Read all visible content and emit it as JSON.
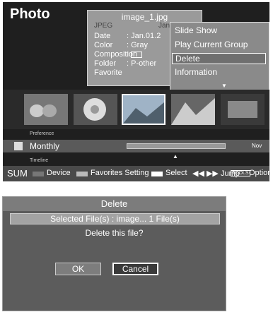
{
  "photo_screen": {
    "title": "Photo",
    "info": {
      "filename": "image_1.jpg",
      "dimension_text": "JPEG",
      "bg_text": "Jan.01.2",
      "rows": [
        {
          "label": "Date",
          "value": ": Jan.01.2"
        },
        {
          "label": "Color",
          "value": ": Gray"
        },
        {
          "label": "Composition",
          "value": ": "
        },
        {
          "label": "Folder",
          "value": ": P-other"
        },
        {
          "label": "Favorite",
          "value": ""
        }
      ]
    },
    "menu": {
      "items": [
        "Slide Show",
        "Play Current Group",
        "Delete",
        "Information"
      ],
      "selected_index": 2
    },
    "preference_label": "Preference",
    "timeline": {
      "mode": "Monthly",
      "end_label": "Nov",
      "label": "Timeline"
    },
    "bottombar": {
      "sum": "SUM",
      "device": "Device",
      "favorites": "Favorites Setting",
      "select": "Select",
      "jump": "◀◀ ▶▶ Jump",
      "tools": "TOOLS",
      "option": "Option"
    },
    "colors": {
      "device_chip": "#777777",
      "favorites_chip": "#bbbbbb",
      "select_chip": "#ffffff"
    }
  },
  "delete_dialog": {
    "title": "Delete",
    "selected_files": "Selected File(s) : image... 1 File(s)",
    "question": "Delete this file?",
    "ok_label": "OK",
    "cancel_label": "Cancel",
    "selected_button": "cancel"
  }
}
